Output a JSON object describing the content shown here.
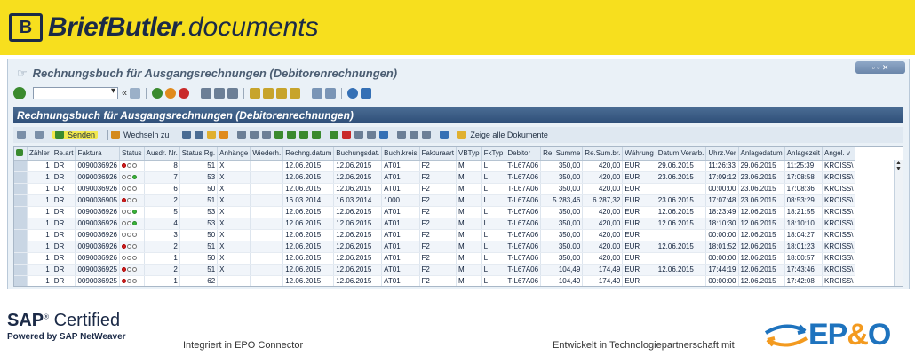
{
  "banner": {
    "brand_name": "BriefButler",
    "brand_domain": ".documents",
    "logo_glyph": "B"
  },
  "window": {
    "title": "Rechnungsbuch für Ausgangsrechnungen (Debitorenrechnungen)",
    "controls": "▫ ▫ ✕"
  },
  "inner": {
    "title": "Rechnungsbuch für Ausgangsrechnungen (Debitorenrechnungen)"
  },
  "toolbar": {
    "send_label": "Senden",
    "switch_label": "Wechseln zu",
    "show_all_label": "Zeige alle Dokumente"
  },
  "grid": {
    "columns": [
      "Zähler",
      "Re.art",
      "Faktura",
      "Status",
      "Ausdr. Nr.",
      "Status Rg.",
      "Anhänge",
      "Wiederh.",
      "Rechng.datum",
      "Buchungsdat.",
      "Buch.kreis",
      "Fakturaart",
      "VBTyp",
      "FkTyp",
      "Debitor",
      "Re. Summe",
      "Re.Sum.br.",
      "Währung",
      "Datum Verarb.",
      "Uhrz.Ver",
      "Anlagedatum",
      "Anlagezeit",
      "Angel. v"
    ],
    "rows": [
      {
        "z": "1",
        "art": "DR",
        "fak": "0090036926",
        "lamp": [
          "red",
          "off",
          "off"
        ],
        "nr": "8",
        "srg": "51",
        "anh": "X",
        "rd": "12.06.2015",
        "bd": "12.06.2015",
        "bk": "AT01",
        "fa": "F2",
        "vb": "M",
        "fk": "L",
        "deb": "T-L67A06",
        "sum": "350,00",
        "br": "420,00",
        "cur": "EUR",
        "dv": "29.06.2015",
        "uv": "11:26:33",
        "ad": "29.06.2015",
        "az": "11:25:39",
        "ang": "KROISS\\"
      },
      {
        "z": "1",
        "art": "DR",
        "fak": "0090036926",
        "lamp": [
          "off",
          "off",
          "grn"
        ],
        "nr": "7",
        "srg": "53",
        "anh": "X",
        "rd": "12.06.2015",
        "bd": "12.06.2015",
        "bk": "AT01",
        "fa": "F2",
        "vb": "M",
        "fk": "L",
        "deb": "T-L67A06",
        "sum": "350,00",
        "br": "420,00",
        "cur": "EUR",
        "dv": "23.06.2015",
        "uv": "17:09:12",
        "ad": "23.06.2015",
        "az": "17:08:58",
        "ang": "KROISS\\"
      },
      {
        "z": "1",
        "art": "DR",
        "fak": "0090036926",
        "lamp": [
          "off",
          "off",
          "off"
        ],
        "nr": "6",
        "srg": "50",
        "anh": "X",
        "rd": "12.06.2015",
        "bd": "12.06.2015",
        "bk": "AT01",
        "fa": "F2",
        "vb": "M",
        "fk": "L",
        "deb": "T-L67A06",
        "sum": "350,00",
        "br": "420,00",
        "cur": "EUR",
        "dv": "",
        "uv": "00:00:00",
        "ad": "23.06.2015",
        "az": "17:08:36",
        "ang": "KROISS\\"
      },
      {
        "z": "1",
        "art": "DR",
        "fak": "0090036905",
        "lamp": [
          "red",
          "off",
          "off"
        ],
        "nr": "2",
        "srg": "51",
        "anh": "X",
        "rd": "16.03.2014",
        "bd": "16.03.2014",
        "bk": "1000",
        "fa": "F2",
        "vb": "M",
        "fk": "L",
        "deb": "T-L67A06",
        "sum": "5.283,46",
        "br": "6.287,32",
        "cur": "EUR",
        "dv": "23.06.2015",
        "uv": "17:07:48",
        "ad": "23.06.2015",
        "az": "08:53:29",
        "ang": "KROISS\\"
      },
      {
        "z": "1",
        "art": "DR",
        "fak": "0090036926",
        "lamp": [
          "off",
          "off",
          "grn"
        ],
        "nr": "5",
        "srg": "53",
        "anh": "X",
        "rd": "12.06.2015",
        "bd": "12.06.2015",
        "bk": "AT01",
        "fa": "F2",
        "vb": "M",
        "fk": "L",
        "deb": "T-L67A06",
        "sum": "350,00",
        "br": "420,00",
        "cur": "EUR",
        "dv": "12.06.2015",
        "uv": "18:23:49",
        "ad": "12.06.2015",
        "az": "18:21:55",
        "ang": "KROISS\\"
      },
      {
        "z": "1",
        "art": "DR",
        "fak": "0090036926",
        "lamp": [
          "off",
          "off",
          "grn"
        ],
        "nr": "4",
        "srg": "53",
        "anh": "X",
        "rd": "12.06.2015",
        "bd": "12.06.2015",
        "bk": "AT01",
        "fa": "F2",
        "vb": "M",
        "fk": "L",
        "deb": "T-L67A06",
        "sum": "350,00",
        "br": "420,00",
        "cur": "EUR",
        "dv": "12.06.2015",
        "uv": "18:10:30",
        "ad": "12.06.2015",
        "az": "18:10:10",
        "ang": "KROISS\\"
      },
      {
        "z": "1",
        "art": "DR",
        "fak": "0090036926",
        "lamp": [
          "off",
          "off",
          "off"
        ],
        "nr": "3",
        "srg": "50",
        "anh": "X",
        "rd": "12.06.2015",
        "bd": "12.06.2015",
        "bk": "AT01",
        "fa": "F2",
        "vb": "M",
        "fk": "L",
        "deb": "T-L67A06",
        "sum": "350,00",
        "br": "420,00",
        "cur": "EUR",
        "dv": "",
        "uv": "00:00:00",
        "ad": "12.06.2015",
        "az": "18:04:27",
        "ang": "KROISS\\"
      },
      {
        "z": "1",
        "art": "DR",
        "fak": "0090036926",
        "lamp": [
          "red",
          "off",
          "off"
        ],
        "nr": "2",
        "srg": "51",
        "anh": "X",
        "rd": "12.06.2015",
        "bd": "12.06.2015",
        "bk": "AT01",
        "fa": "F2",
        "vb": "M",
        "fk": "L",
        "deb": "T-L67A06",
        "sum": "350,00",
        "br": "420,00",
        "cur": "EUR",
        "dv": "12.06.2015",
        "uv": "18:01:52",
        "ad": "12.06.2015",
        "az": "18:01:23",
        "ang": "KROISS\\"
      },
      {
        "z": "1",
        "art": "DR",
        "fak": "0090036926",
        "lamp": [
          "off",
          "off",
          "off"
        ],
        "nr": "1",
        "srg": "50",
        "anh": "X",
        "rd": "12.06.2015",
        "bd": "12.06.2015",
        "bk": "AT01",
        "fa": "F2",
        "vb": "M",
        "fk": "L",
        "deb": "T-L67A06",
        "sum": "350,00",
        "br": "420,00",
        "cur": "EUR",
        "dv": "",
        "uv": "00:00:00",
        "ad": "12.06.2015",
        "az": "18:00:57",
        "ang": "KROISS\\"
      },
      {
        "z": "1",
        "art": "DR",
        "fak": "0090036925",
        "lamp": [
          "red",
          "off",
          "off"
        ],
        "nr": "2",
        "srg": "51",
        "anh": "X",
        "rd": "12.06.2015",
        "bd": "12.06.2015",
        "bk": "AT01",
        "fa": "F2",
        "vb": "M",
        "fk": "L",
        "deb": "T-L67A06",
        "sum": "104,49",
        "br": "174,49",
        "cur": "EUR",
        "dv": "12.06.2015",
        "uv": "17:44:19",
        "ad": "12.06.2015",
        "az": "17:43:46",
        "ang": "KROISS\\"
      },
      {
        "z": "1",
        "art": "DR",
        "fak": "0090036925",
        "lamp": [
          "red",
          "off",
          "off"
        ],
        "nr": "1",
        "srg": "62",
        "anh": "",
        "rd": "12.06.2015",
        "bd": "12.06.2015",
        "bk": "AT01",
        "fa": "F2",
        "vb": "M",
        "fk": "L",
        "deb": "T-L67A06",
        "sum": "104,49",
        "br": "174,49",
        "cur": "EUR",
        "dv": "",
        "uv": "00:00:00",
        "ad": "12.06.2015",
        "az": "17:42:08",
        "ang": "KROISS\\"
      }
    ]
  },
  "footer": {
    "sap_brand": "SAP",
    "sap_certified": "Certified",
    "sap_powered": "Powered by SAP NetWeaver",
    "mid_text": "Integriert in EPO Connector",
    "right_text": "Entwickelt in Technologiepartnerschaft mit",
    "ep_logo": "EP",
    "ep_amp": "&",
    "ep_o": "O"
  }
}
